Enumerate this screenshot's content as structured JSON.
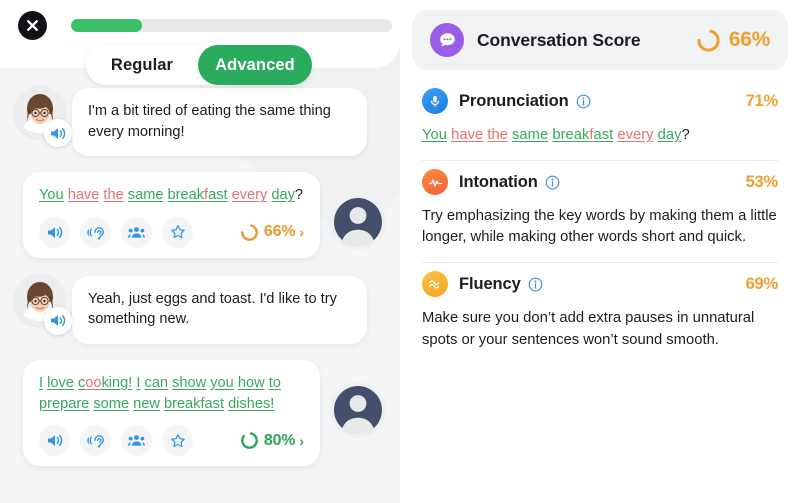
{
  "left": {
    "close_icon": "close-icon",
    "progress": {
      "percent": 22,
      "label": "22%"
    },
    "mode_toggle": {
      "regular_label": "Regular",
      "advanced_label": "Advanced",
      "selected": "Advanced"
    },
    "messages": [
      {
        "role": "bot",
        "text": "I'm a bit tired of eating the same thing every morning!",
        "speaker_icon": "speaker-icon"
      },
      {
        "role": "user",
        "words": [
          {
            "t": "You",
            "c": "g"
          },
          {
            "t": "have",
            "c": "r"
          },
          {
            "t": "the",
            "c": "r"
          },
          {
            "t": "same",
            "c": "g"
          },
          {
            "t": "break",
            "c": "g"
          },
          {
            "t": "f",
            "c": "r"
          },
          {
            "t": "ast",
            "c": "g"
          },
          {
            "t": "every",
            "c": "r"
          },
          {
            "t": "day",
            "c": "g"
          },
          {
            "t": "?",
            "c": "n"
          }
        ],
        "actions": [
          "speaker-icon",
          "listen-ear-icon",
          "people-group-icon",
          "star-icon"
        ],
        "score": "66%",
        "score_color": "#e69a2e",
        "score_ratio": 66,
        "chevron": "›"
      },
      {
        "role": "bot",
        "text": "Yeah, just eggs and toast. I'd like to try something new.",
        "speaker_icon": "speaker-icon"
      },
      {
        "role": "user",
        "words": [
          {
            "t": "I",
            "c": "g"
          },
          {
            "t": "love",
            "c": "g"
          },
          {
            "t": "c",
            "c": "g"
          },
          {
            "t": "oo",
            "c": "r"
          },
          {
            "t": "king!",
            "c": "g"
          },
          {
            "t": "I",
            "c": "g"
          },
          {
            "t": "can",
            "c": "g"
          },
          {
            "t": "show",
            "c": "g"
          },
          {
            "t": "you",
            "c": "g"
          },
          {
            "t": "how",
            "c": "g"
          },
          {
            "t": "to",
            "c": "g"
          },
          {
            "t": "prepare",
            "c": "g"
          },
          {
            "t": "some",
            "c": "g"
          },
          {
            "t": "new",
            "c": "g"
          },
          {
            "t": "breakfast",
            "c": "g"
          },
          {
            "t": "dishes!",
            "c": "g"
          }
        ],
        "actions": [
          "speaker-icon",
          "listen-ear-icon",
          "people-group-icon",
          "star-icon"
        ],
        "score": "80%",
        "score_color": "#2fa35e",
        "score_ratio": 80,
        "chevron": "›"
      }
    ]
  },
  "right": {
    "conversation": {
      "icon": "chat-bubble-icon",
      "title": "Conversation Score",
      "score": "66%",
      "score_ratio": 66,
      "accent": "#f0a030"
    },
    "metrics": [
      {
        "icon": "microphone-icon",
        "name": "Pronunciation",
        "pct": "71%",
        "type": "sentence",
        "words": [
          {
            "t": "You",
            "c": "g"
          },
          {
            "t": "have",
            "c": "r"
          },
          {
            "t": "the",
            "c": "r"
          },
          {
            "t": "same",
            "c": "g"
          },
          {
            "t": "break",
            "c": "g"
          },
          {
            "t": "f",
            "c": "r"
          },
          {
            "t": "ast",
            "c": "g"
          },
          {
            "t": "every",
            "c": "r"
          },
          {
            "t": "day",
            "c": "g"
          },
          {
            "t": "?",
            "c": "n"
          }
        ]
      },
      {
        "icon": "waveform-icon",
        "name": "Intonation",
        "pct": "53%",
        "type": "text",
        "body": "Try emphasizing the key words by making them a little longer, while making other words short and quick."
      },
      {
        "icon": "fluency-wave-icon",
        "name": "Fluency",
        "pct": "69%",
        "type": "text",
        "body": "Make sure you don’t add extra pauses in unnatural spots or your sentences won’t sound smooth."
      }
    ],
    "info_icon": "info-icon"
  },
  "colors": {
    "green": "#3aa75f",
    "red": "#e2716f",
    "orange": "#f0a030",
    "brand_green": "#2bab5d",
    "purple": "#9b5de5",
    "blue": "#2f95e8"
  }
}
